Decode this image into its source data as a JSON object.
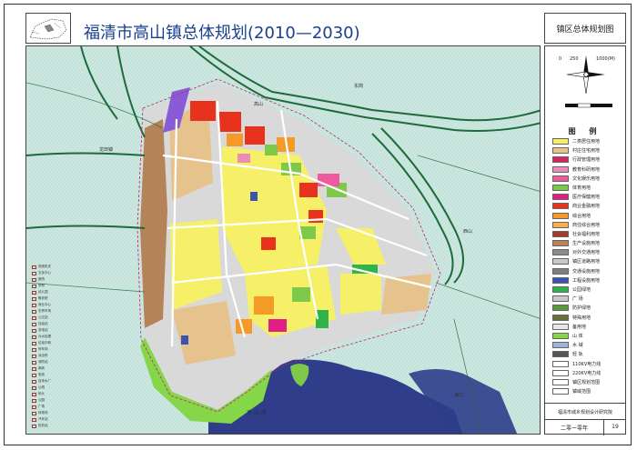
{
  "header": {
    "title": "福清市高山镇总体规划(2010—2030)"
  },
  "side": {
    "title": "镇区总体规划图",
    "scale": {
      "zero": "0",
      "mid": "250",
      "max": "1000(M)"
    },
    "legend_title": "图 例",
    "legend": [
      {
        "label": "二类居住用地",
        "color": "#f5f068"
      },
      {
        "label": "村庄住宅用地",
        "color": "#e6c38c"
      },
      {
        "label": "行政管理用地",
        "color": "#d4265e"
      },
      {
        "label": "教育科研用地",
        "color": "#ee8ab8"
      },
      {
        "label": "文化娱乐用地",
        "color": "#ee5aa0"
      },
      {
        "label": "体育用地",
        "color": "#7ec84a"
      },
      {
        "label": "医疗保健用地",
        "color": "#e11f84"
      },
      {
        "label": "商业金融用地",
        "color": "#e8321e"
      },
      {
        "label": "综合用地",
        "color": "#f59a27"
      },
      {
        "label": "商住综合用地",
        "color": "#f7b04a"
      },
      {
        "label": "社会福利用地",
        "color": "#a23b2a"
      },
      {
        "label": "生产设施用地",
        "color": "#b5835a"
      },
      {
        "label": "对外交通用地",
        "color": "#8b8b8b"
      },
      {
        "label": "镇区道路用地",
        "color": "#c8c8c8"
      },
      {
        "label": "交通设施用地",
        "color": "#7e7e7e"
      },
      {
        "label": "工程设施用地",
        "color": "#3a55b0"
      },
      {
        "label": "公园绿地",
        "color": "#2fb44a"
      },
      {
        "label": "广 场",
        "color": "#c9c9c9"
      },
      {
        "label": "防护绿地",
        "color": "#5a9a3a"
      },
      {
        "label": "特殊用地",
        "color": "#6a6e3a"
      },
      {
        "label": "备用地",
        "color": "#e8e8e8"
      },
      {
        "label": "山 体",
        "color": "#86d64a"
      },
      {
        "label": "水 域",
        "color": "#9db4e0"
      },
      {
        "label": "轻 轨",
        "color": "#555555"
      },
      {
        "label": "110KV电力线",
        "color": "#ffffff"
      },
      {
        "label": "220KV电力线",
        "color": "#ffffff"
      },
      {
        "label": "镇区规划范围",
        "color": "#ffffff"
      },
      {
        "label": "镇域范围",
        "color": "#ffffff"
      }
    ],
    "org": "福清市城乡规划设计研究院",
    "date": "二零一零年",
    "page": "19"
  },
  "map": {
    "bay_label": "高 山 湾",
    "place_labels": [
      "东岗",
      "高山",
      "龙田镇",
      "西山",
      "海口"
    ],
    "notes": [
      "党政机关",
      "文化中心",
      "医院",
      "学校",
      "幼儿园",
      "敬老院",
      "商业中心",
      "农贸市场",
      "公交站",
      "加油站",
      "变电站",
      "污水处理",
      "垃圾中转",
      "停车场",
      "派出所",
      "消防站",
      "邮政",
      "电信",
      "自来水厂",
      "公厕",
      "码头",
      "公园",
      "广场",
      "体育场",
      "汽车站",
      "供热站"
    ]
  },
  "colors": {
    "water": "#cbe7e0",
    "bay": "#2f3d8a",
    "residential": "#f5f068",
    "village": "#e6c38c",
    "commercial": "#e8321e",
    "green": "#7ec84a",
    "road": "#d9d9d9",
    "expressway": "#1f6a3a",
    "industry": "#b5835a"
  }
}
